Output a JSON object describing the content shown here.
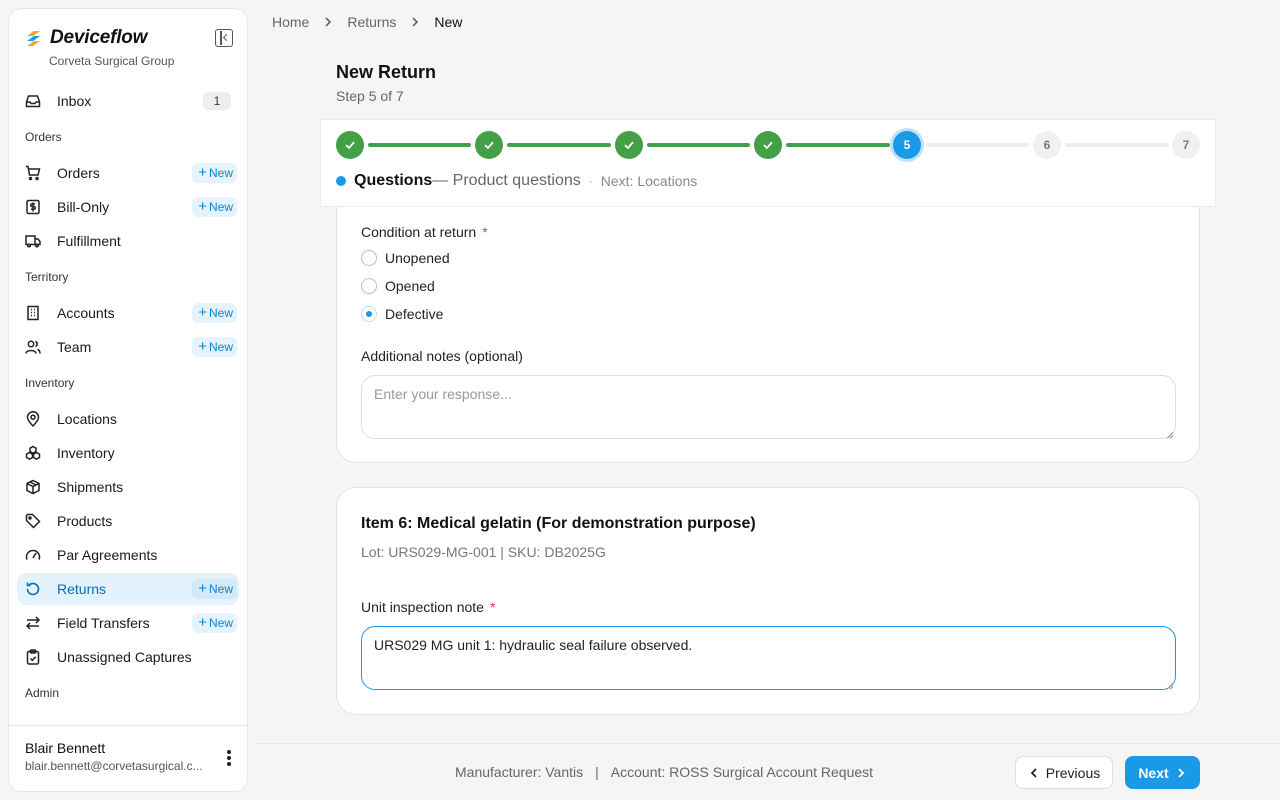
{
  "brand": {
    "name": "Deviceflow",
    "org": "Corveta Surgical Group"
  },
  "sidebar": {
    "top": [
      {
        "label": "Inbox",
        "icon": "inbox-icon",
        "badge": "1"
      }
    ],
    "sections": [
      {
        "title": "Orders",
        "items": [
          {
            "label": "Orders",
            "icon": "cart-icon",
            "new": "New"
          },
          {
            "label": "Bill-Only",
            "icon": "bill-icon",
            "new": "New"
          },
          {
            "label": "Fulfillment",
            "icon": "truck-icon"
          }
        ]
      },
      {
        "title": "Territory",
        "items": [
          {
            "label": "Accounts",
            "icon": "building-icon",
            "new": "New"
          },
          {
            "label": "Team",
            "icon": "users-icon",
            "new": "New"
          }
        ]
      },
      {
        "title": "Inventory",
        "items": [
          {
            "label": "Locations",
            "icon": "map-pin-icon"
          },
          {
            "label": "Inventory",
            "icon": "boxes-icon"
          },
          {
            "label": "Shipments",
            "icon": "package-icon"
          },
          {
            "label": "Products",
            "icon": "tag-icon"
          },
          {
            "label": "Par Agreements",
            "icon": "gauge-icon"
          },
          {
            "label": "Returns",
            "icon": "rotate-ccw-icon",
            "new": "New",
            "active": true
          },
          {
            "label": "Field Transfers",
            "icon": "arrows-exchange-icon",
            "new": "New"
          },
          {
            "label": "Unassigned Captures",
            "icon": "clipboard-check-icon"
          }
        ]
      },
      {
        "title": "Admin",
        "items": []
      }
    ],
    "user": {
      "name": "Blair Bennett",
      "email": "blair.bennett@corvetasurgical.c..."
    }
  },
  "breadcrumb": [
    "Home",
    "Returns",
    "New"
  ],
  "page": {
    "title": "New Return",
    "subtitle": "Step 5 of 7"
  },
  "stepper": {
    "steps": [
      {
        "n": "1",
        "state": "done"
      },
      {
        "n": "2",
        "state": "done"
      },
      {
        "n": "3",
        "state": "done"
      },
      {
        "n": "4",
        "state": "done"
      },
      {
        "n": "5",
        "state": "current"
      },
      {
        "n": "6",
        "state": "todo"
      },
      {
        "n": "7",
        "state": "todo"
      }
    ],
    "current_label": "Questions",
    "current_desc": "— Product questions",
    "separator": "·",
    "next": "Next: Locations"
  },
  "card1": {
    "condition_label": "Condition at return",
    "required_mark": "*",
    "options": [
      {
        "label": "Unopened",
        "checked": false
      },
      {
        "label": "Opened",
        "checked": false
      },
      {
        "label": "Defective",
        "checked": true
      }
    ],
    "notes_label": "Additional notes (optional)",
    "notes_placeholder": "Enter your response..."
  },
  "card2": {
    "title": "Item 6: Medical gelatin (For demonstration purpose)",
    "lot_sku": "Lot: URS029-MG-001 | SKU: DB2025G",
    "inspection_label": "Unit inspection note",
    "required_mark": "*",
    "inspection_value": "URS029 MG unit 1: hydraulic seal failure observed."
  },
  "footer": {
    "manufacturer": "Manufacturer: Vantis",
    "divider": "|",
    "account": "Account: ROSS Surgical Account Request",
    "prev": "Previous",
    "next": "Next"
  },
  "colors": {
    "accent": "#1a99e6",
    "done": "#43a047",
    "required": "#e53935"
  }
}
